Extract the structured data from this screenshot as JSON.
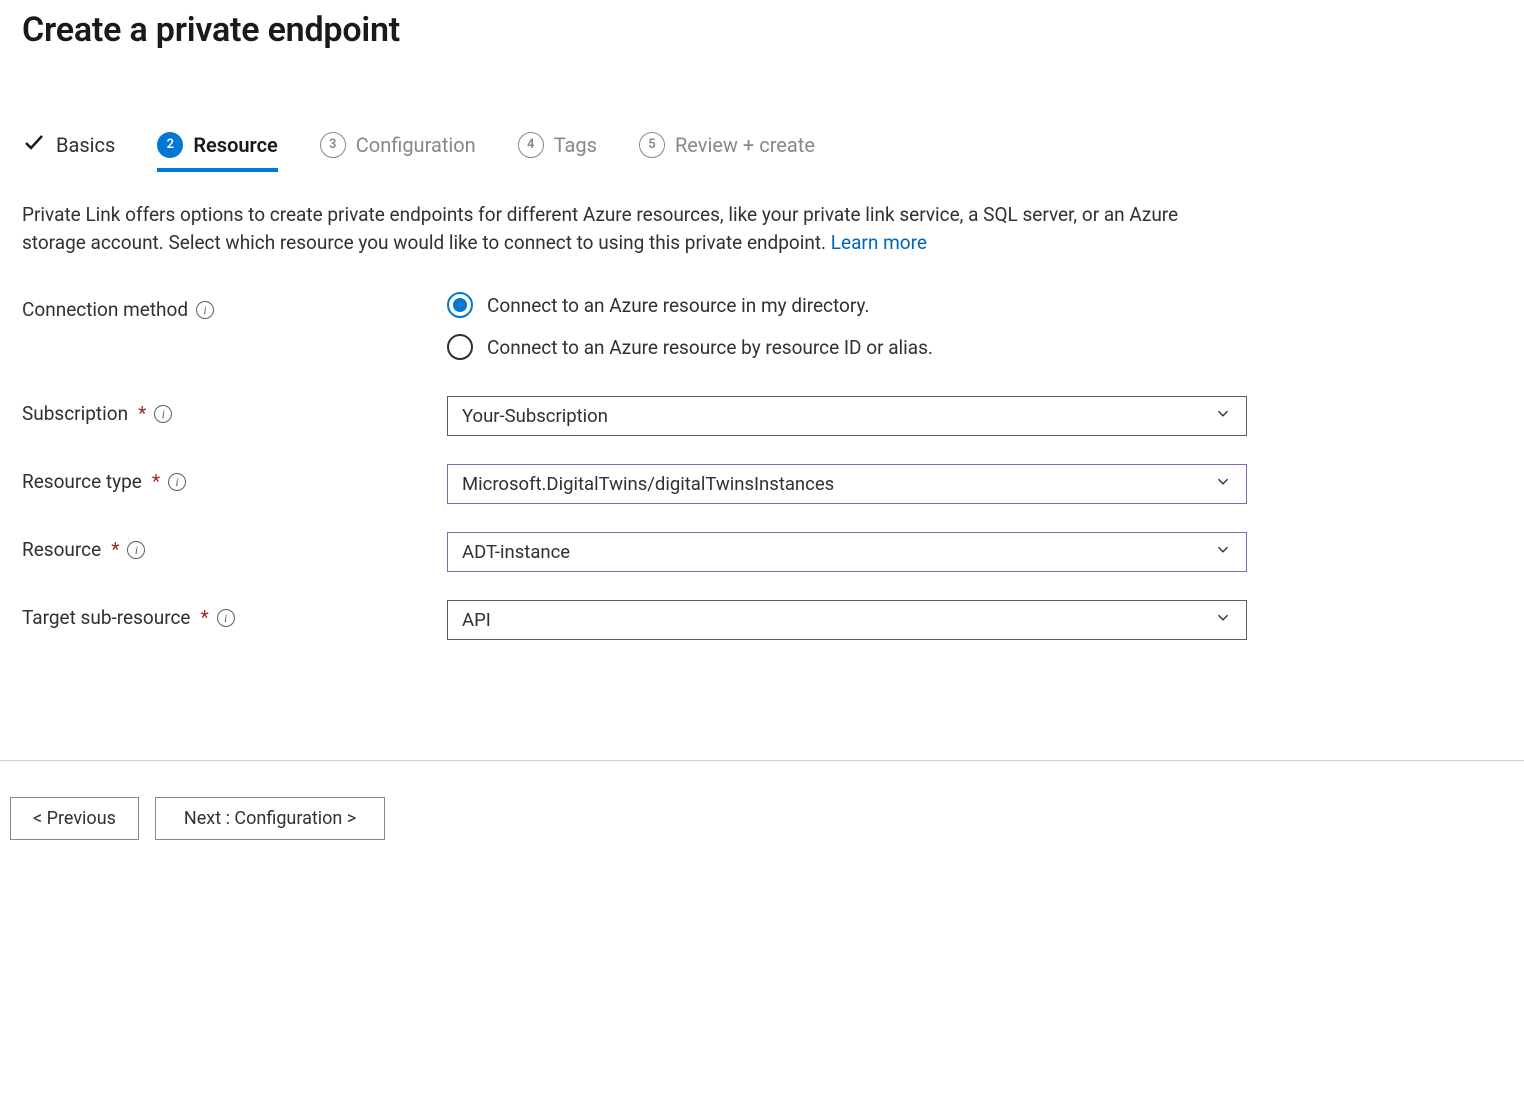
{
  "header": {
    "title": "Create a private endpoint"
  },
  "tabs": [
    {
      "label": "Basics",
      "state": "done"
    },
    {
      "label": "Resource",
      "state": "active",
      "step": "2"
    },
    {
      "label": "Configuration",
      "state": "pending",
      "step": "3"
    },
    {
      "label": "Tags",
      "state": "pending",
      "step": "4"
    },
    {
      "label": "Review + create",
      "state": "pending",
      "step": "5"
    }
  ],
  "description": {
    "text": "Private Link offers options to create private endpoints for different Azure resources, like your private link service, a SQL server, or an Azure storage account. Select which resource you would like to connect to using this private endpoint.  ",
    "learn_more": "Learn more"
  },
  "form": {
    "connection_method": {
      "label": "Connection method",
      "options": [
        "Connect to an Azure resource in my directory.",
        "Connect to an Azure resource by resource ID or alias."
      ],
      "selected_index": 0
    },
    "subscription": {
      "label": "Subscription",
      "value": "Your-Subscription"
    },
    "resource_type": {
      "label": "Resource type",
      "value": "Microsoft.DigitalTwins/digitalTwinsInstances"
    },
    "resource": {
      "label": "Resource",
      "value": "ADT-instance"
    },
    "target_sub_resource": {
      "label": "Target sub-resource",
      "value": "API"
    }
  },
  "footer": {
    "previous": "< Previous",
    "next": "Next : Configuration >"
  }
}
